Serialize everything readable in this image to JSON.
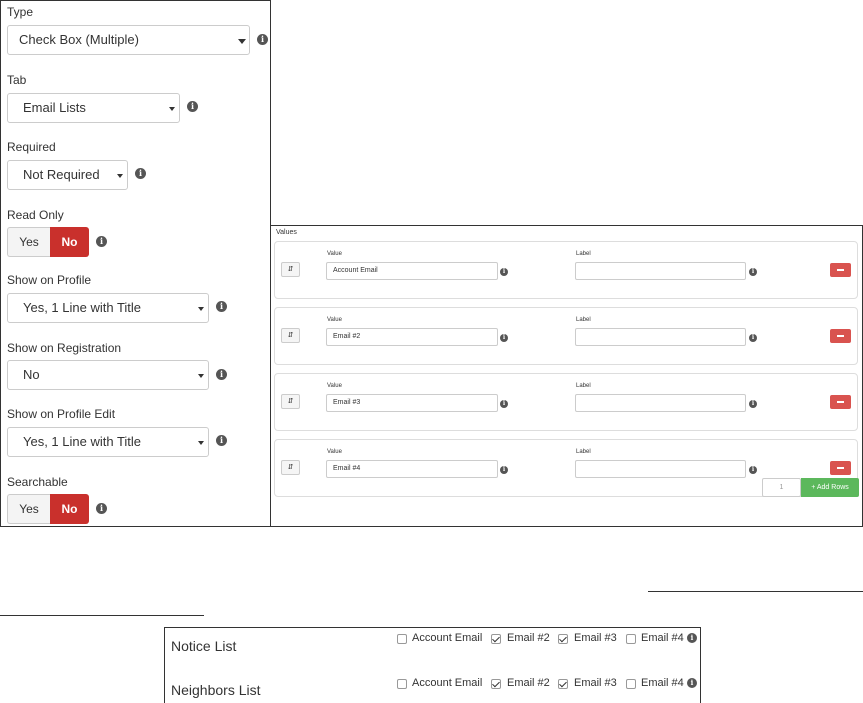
{
  "fields": {
    "type": {
      "label": "Type",
      "value": "Check Box (Multiple)"
    },
    "tab": {
      "label": "Tab",
      "value": "Email Lists"
    },
    "required": {
      "label": "Required",
      "value": "Not Required"
    },
    "read_only": {
      "label": "Read Only",
      "yes": "Yes",
      "no": "No",
      "selected": "No"
    },
    "show_on_profile": {
      "label": "Show on Profile",
      "value": "Yes, 1 Line with Title"
    },
    "show_on_registration": {
      "label": "Show on Registration",
      "value": "No"
    },
    "show_on_profile_edit": {
      "label": "Show on Profile Edit",
      "value": "Yes, 1 Line with Title"
    },
    "searchable": {
      "label": "Searchable",
      "yes": "Yes",
      "no": "No",
      "selected": "No"
    }
  },
  "info_glyph": "i",
  "values_panel": {
    "title": "Values",
    "value_label": "Value",
    "label_label": "Label",
    "rows": [
      {
        "value": "Account Email",
        "label": ""
      },
      {
        "value": "Email #2",
        "label": ""
      },
      {
        "value": "Email #3",
        "label": ""
      },
      {
        "value": "Email #4",
        "label": ""
      }
    ],
    "row_count": "1",
    "add_rows_label": "+ Add Rows"
  },
  "preview": {
    "lists": [
      {
        "name": "Notice List",
        "options": [
          {
            "label": "Account Email",
            "checked": false
          },
          {
            "label": "Email #2",
            "checked": true
          },
          {
            "label": "Email #3",
            "checked": true
          },
          {
            "label": "Email #4",
            "checked": false
          }
        ]
      },
      {
        "name": "Neighbors List",
        "options": [
          {
            "label": "Account Email",
            "checked": false
          },
          {
            "label": "Email #2",
            "checked": true
          },
          {
            "label": "Email #3",
            "checked": true
          },
          {
            "label": "Email #4",
            "checked": false
          }
        ]
      }
    ]
  },
  "colors": {
    "danger": "#c9302c",
    "success": "#5cb85c",
    "remove": "#d9534f"
  }
}
